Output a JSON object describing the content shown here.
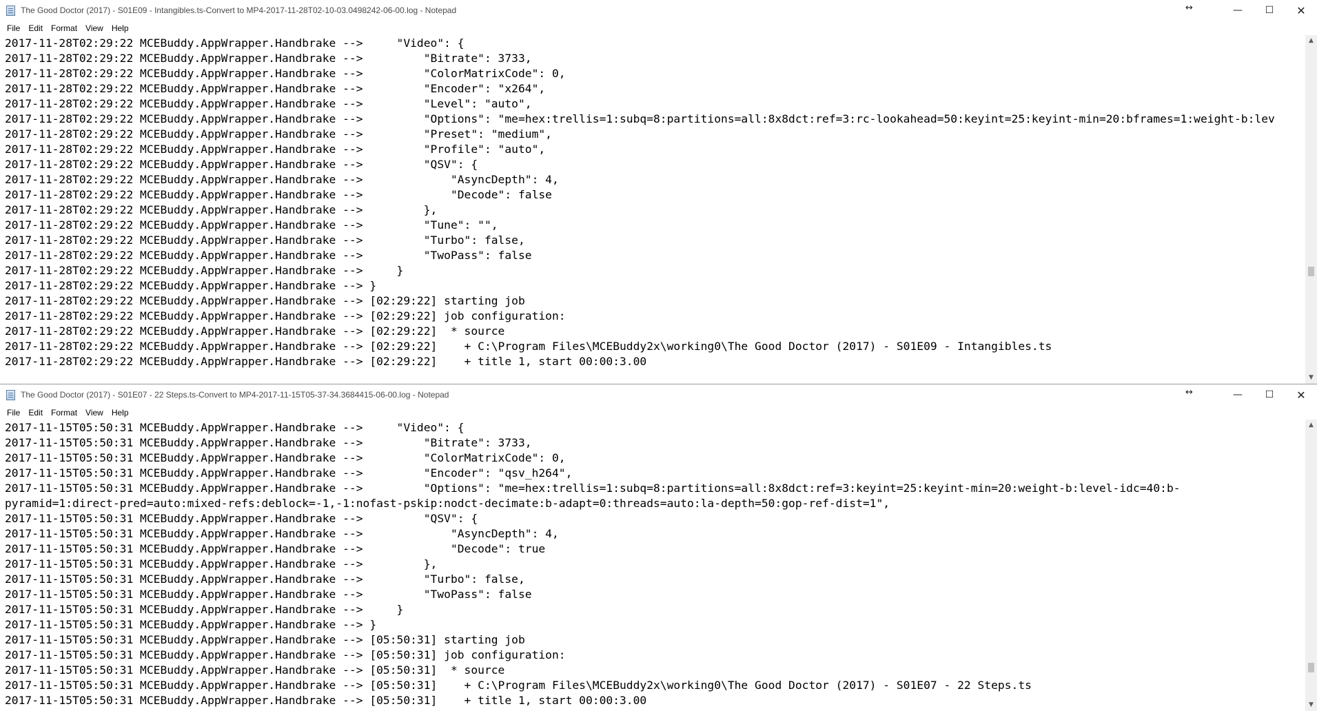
{
  "window1": {
    "title": "The Good Doctor (2017) - S01E09 - Intangibles.ts-Convert to MP4-2017-11-28T02-10-03.0498242-06-00.log - Notepad",
    "lines": [
      "2017-11-28T02:29:22 MCEBuddy.AppWrapper.Handbrake -->     \"Video\": {",
      "2017-11-28T02:29:22 MCEBuddy.AppWrapper.Handbrake -->         \"Bitrate\": 3733,",
      "2017-11-28T02:29:22 MCEBuddy.AppWrapper.Handbrake -->         \"ColorMatrixCode\": 0,",
      "2017-11-28T02:29:22 MCEBuddy.AppWrapper.Handbrake -->         \"Encoder\": \"x264\",",
      "2017-11-28T02:29:22 MCEBuddy.AppWrapper.Handbrake -->         \"Level\": \"auto\",",
      "2017-11-28T02:29:22 MCEBuddy.AppWrapper.Handbrake -->         \"Options\": \"me=hex:trellis=1:subq=8:partitions=all:8x8dct:ref=3:rc-lookahead=50:keyint=25:keyint-min=20:bframes=1:weight-b:lev",
      "2017-11-28T02:29:22 MCEBuddy.AppWrapper.Handbrake -->         \"Preset\": \"medium\",",
      "2017-11-28T02:29:22 MCEBuddy.AppWrapper.Handbrake -->         \"Profile\": \"auto\",",
      "2017-11-28T02:29:22 MCEBuddy.AppWrapper.Handbrake -->         \"QSV\": {",
      "2017-11-28T02:29:22 MCEBuddy.AppWrapper.Handbrake -->             \"AsyncDepth\": 4,",
      "2017-11-28T02:29:22 MCEBuddy.AppWrapper.Handbrake -->             \"Decode\": false",
      "2017-11-28T02:29:22 MCEBuddy.AppWrapper.Handbrake -->         },",
      "2017-11-28T02:29:22 MCEBuddy.AppWrapper.Handbrake -->         \"Tune\": \"\",",
      "2017-11-28T02:29:22 MCEBuddy.AppWrapper.Handbrake -->         \"Turbo\": false,",
      "2017-11-28T02:29:22 MCEBuddy.AppWrapper.Handbrake -->         \"TwoPass\": false",
      "2017-11-28T02:29:22 MCEBuddy.AppWrapper.Handbrake -->     }",
      "2017-11-28T02:29:22 MCEBuddy.AppWrapper.Handbrake --> }",
      "2017-11-28T02:29:22 MCEBuddy.AppWrapper.Handbrake --> [02:29:22] starting job",
      "2017-11-28T02:29:22 MCEBuddy.AppWrapper.Handbrake --> [02:29:22] job configuration:",
      "2017-11-28T02:29:22 MCEBuddy.AppWrapper.Handbrake --> [02:29:22]  * source",
      "2017-11-28T02:29:22 MCEBuddy.AppWrapper.Handbrake --> [02:29:22]    + C:\\Program Files\\MCEBuddy2x\\working0\\The Good Doctor (2017) - S01E09 - Intangibles.ts",
      "2017-11-28T02:29:22 MCEBuddy.AppWrapper.Handbrake --> [02:29:22]    + title 1, start 00:00:3.00"
    ]
  },
  "window2": {
    "title": "The Good Doctor (2017) - S01E07 - 22 Steps.ts-Convert to MP4-2017-11-15T05-37-34.3684415-06-00.log - Notepad",
    "lines": [
      "2017-11-15T05:50:31 MCEBuddy.AppWrapper.Handbrake -->     \"Video\": {",
      "2017-11-15T05:50:31 MCEBuddy.AppWrapper.Handbrake -->         \"Bitrate\": 3733,",
      "2017-11-15T05:50:31 MCEBuddy.AppWrapper.Handbrake -->         \"ColorMatrixCode\": 0,",
      "2017-11-15T05:50:31 MCEBuddy.AppWrapper.Handbrake -->         \"Encoder\": \"qsv_h264\",",
      "2017-11-15T05:50:31 MCEBuddy.AppWrapper.Handbrake -->         \"Options\": \"me=hex:trellis=1:subq=8:partitions=all:8x8dct:ref=3:keyint=25:keyint-min=20:weight-b:level-idc=40:b-",
      "pyramid=1:direct-pred=auto:mixed-refs:deblock=-1,-1:nofast-pskip:nodct-decimate:b-adapt=0:threads=auto:la-depth=50:gop-ref-dist=1\",",
      "2017-11-15T05:50:31 MCEBuddy.AppWrapper.Handbrake -->         \"QSV\": {",
      "2017-11-15T05:50:31 MCEBuddy.AppWrapper.Handbrake -->             \"AsyncDepth\": 4,",
      "2017-11-15T05:50:31 MCEBuddy.AppWrapper.Handbrake -->             \"Decode\": true",
      "2017-11-15T05:50:31 MCEBuddy.AppWrapper.Handbrake -->         },",
      "2017-11-15T05:50:31 MCEBuddy.AppWrapper.Handbrake -->         \"Turbo\": false,",
      "2017-11-15T05:50:31 MCEBuddy.AppWrapper.Handbrake -->         \"TwoPass\": false",
      "2017-11-15T05:50:31 MCEBuddy.AppWrapper.Handbrake -->     }",
      "2017-11-15T05:50:31 MCEBuddy.AppWrapper.Handbrake --> }",
      "2017-11-15T05:50:31 MCEBuddy.AppWrapper.Handbrake --> [05:50:31] starting job",
      "2017-11-15T05:50:31 MCEBuddy.AppWrapper.Handbrake --> [05:50:31] job configuration:",
      "2017-11-15T05:50:31 MCEBuddy.AppWrapper.Handbrake --> [05:50:31]  * source",
      "2017-11-15T05:50:31 MCEBuddy.AppWrapper.Handbrake --> [05:50:31]    + C:\\Program Files\\MCEBuddy2x\\working0\\The Good Doctor (2017) - S01E07 - 22 Steps.ts",
      "2017-11-15T05:50:31 MCEBuddy.AppWrapper.Handbrake --> [05:50:31]    + title 1, start 00:00:3.00"
    ]
  },
  "menu": {
    "file": "File",
    "edit": "Edit",
    "format": "Format",
    "view": "View",
    "help": "Help"
  },
  "controls": {
    "minimize": "—",
    "maximize": "☐",
    "close": "✕",
    "resize": "↔"
  }
}
